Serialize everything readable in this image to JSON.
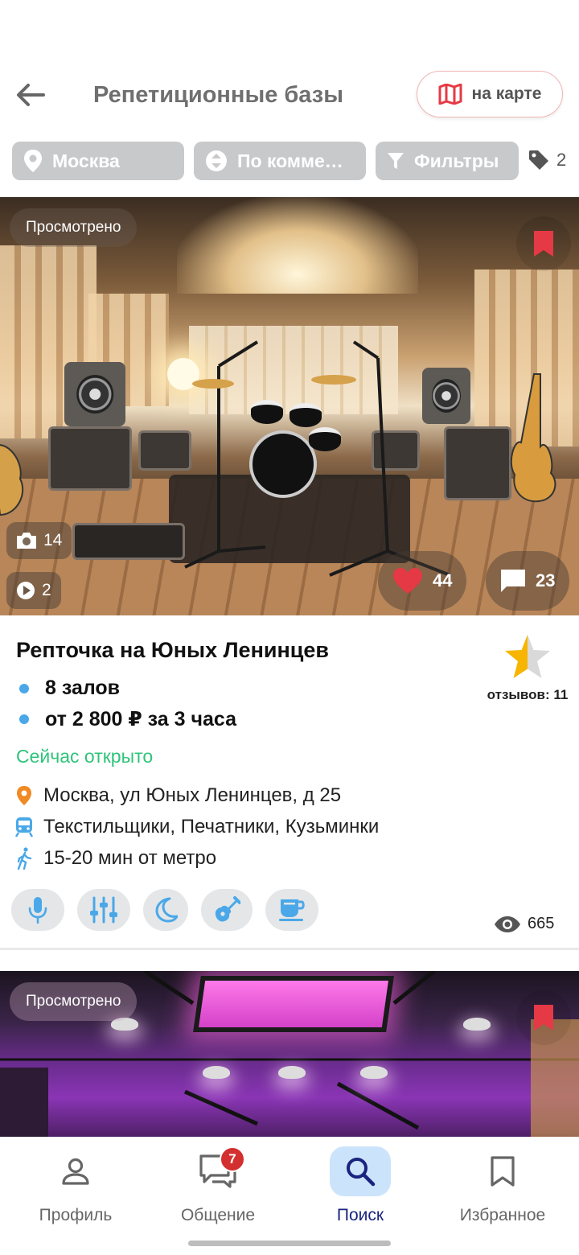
{
  "header": {
    "title": "Репетиционные базы",
    "map_button": "на карте"
  },
  "filters": {
    "city": "Москва",
    "sort": "По комме…",
    "filters": "Фильтры",
    "tag_count": "2"
  },
  "listing": {
    "viewed": "Просмотрено",
    "photos": "14",
    "videos": "2",
    "likes": "44",
    "comments": "23",
    "name": "Репточка на Юных Ленинцев",
    "details": [
      "8 залов",
      "от 2 800 ₽ за 3 часа"
    ],
    "status": "Сейчас открыто",
    "address": "Москва, ул Юных Ленинцев, д 25",
    "metro": "Текстильщики, Печатники, Кузьминки",
    "walk": "15-20 мин от метро",
    "reviews": "отзывов: 11",
    "rating_fill": 0.5,
    "amenities": [
      "microphone-icon",
      "mixer-icon",
      "night-icon",
      "guitar-icon",
      "coffee-icon"
    ],
    "views": "665"
  },
  "listing2": {
    "viewed": "Просмотрено"
  },
  "nav": {
    "items": [
      {
        "label": "Профиль",
        "icon": "profile-icon"
      },
      {
        "label": "Общение",
        "icon": "chat-icon",
        "badge": "7"
      },
      {
        "label": "Поиск",
        "icon": "search-icon"
      },
      {
        "label": "Избранное",
        "icon": "bookmark-icon"
      }
    ],
    "active": "Поиск"
  },
  "colors": {
    "accent_red": "#e53945",
    "accent_blue": "#1a237e",
    "open_green": "#2fc47a",
    "bullet_blue": "#4aa8e8"
  }
}
